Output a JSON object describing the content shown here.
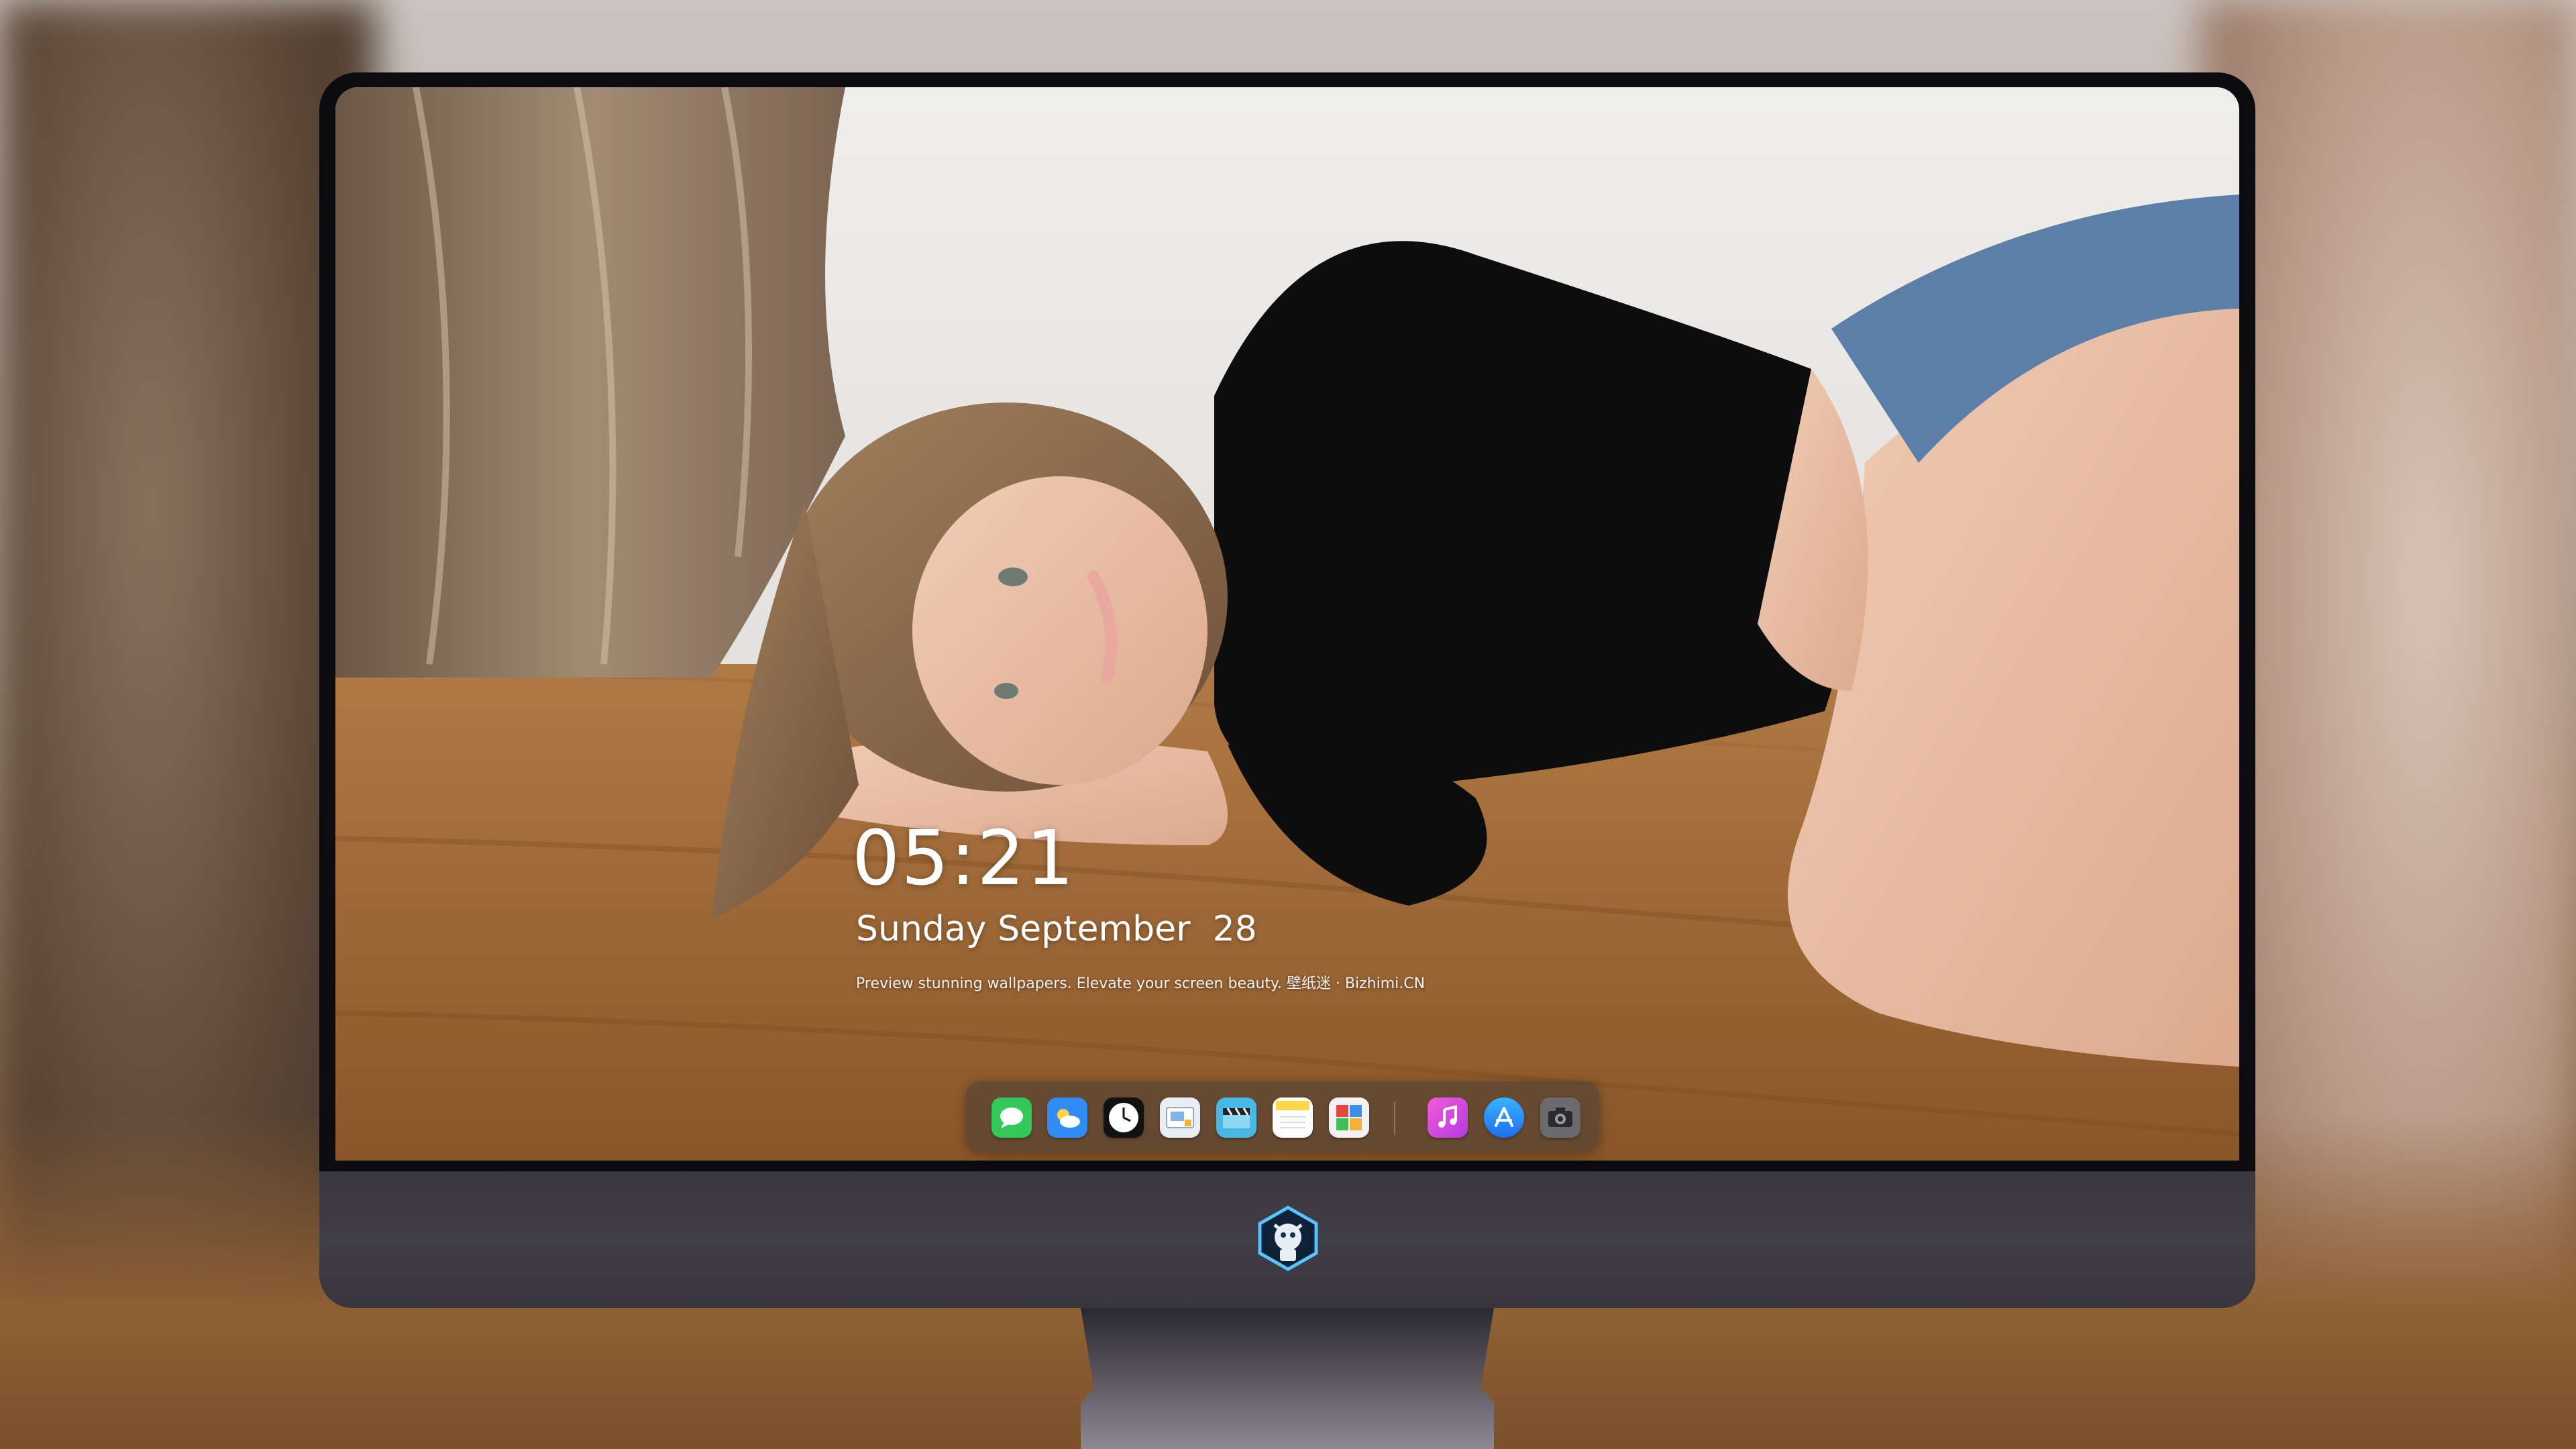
{
  "lockscreen": {
    "time": "05:21",
    "date": "Sunday September  28",
    "tagline": "Preview stunning wallpapers. Elevate your screen beauty. 壁纸迷 · Bizhimi.CN"
  },
  "dock": {
    "apps": [
      {
        "name": "messages-icon",
        "color": "#34c759"
      },
      {
        "name": "weather-icon",
        "color": "#2f8cf5"
      },
      {
        "name": "clock-icon",
        "color": "#111111"
      },
      {
        "name": "preview-icon",
        "color": "#e9eef5"
      },
      {
        "name": "claquette-icon",
        "color": "#47b7e6"
      },
      {
        "name": "notes-icon",
        "color": "#ffd84a"
      },
      {
        "name": "photo-booth-icon",
        "color": "#f2f2f2"
      },
      {
        "name": "music-icon",
        "color": "#d53ad9"
      },
      {
        "name": "app-store-icon",
        "color": "#1f8ef6"
      },
      {
        "name": "camera-icon",
        "color": "#6b6b6e"
      }
    ]
  },
  "colors": {
    "monitor_chin": "#3a373f",
    "bezel": "#0c0c10",
    "dock_background": "rgba(70,60,55,0.55)"
  }
}
